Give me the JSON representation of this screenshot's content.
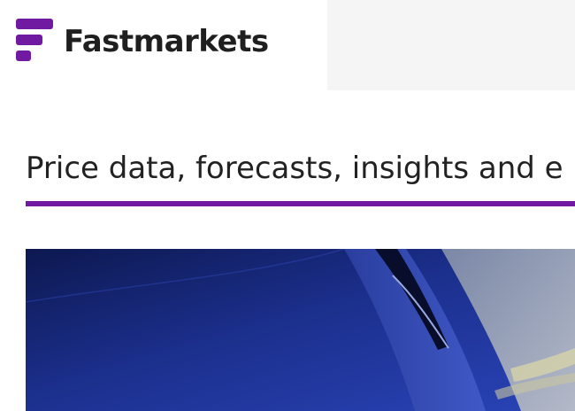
{
  "brand": {
    "name": "Fastmarkets",
    "color": "#6f1aa0",
    "logo_icon": "fastmarkets-logo-icon"
  },
  "headline": {
    "text": "Price data, forecasts, insights and e"
  },
  "hero": {
    "icon": "hero-image-car-icon"
  }
}
